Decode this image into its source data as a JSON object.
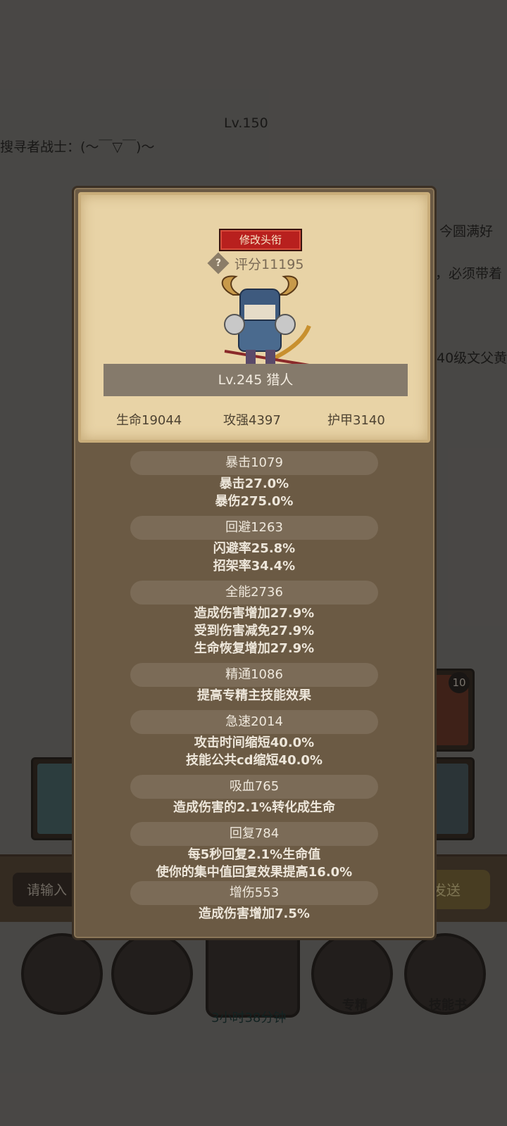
{
  "background": {
    "notice_right": "Lv.150",
    "chat_line": "搜寻者战士：(～￣▽￣)～",
    "side_text_1": "今圆满好",
    "side_text_2": "，必须带着",
    "side_text_3": "40级文父黄",
    "card_badge": "10",
    "input_placeholder": "请输入",
    "send_label": "发送",
    "btn_mastery": "专精",
    "btn_skillbook": "技能书",
    "timer": "3小时38分钟"
  },
  "modal": {
    "title_button": "修改头衔",
    "help": "?",
    "score": "评分11195",
    "level_class": "Lv.245 猎人",
    "primary_stats": {
      "hp": "生命19044",
      "atk": "攻强4397",
      "armor": "护甲3140"
    },
    "stats": [
      {
        "head": "暴击1079",
        "lines": [
          "暴击27.0%",
          "暴伤275.0%"
        ]
      },
      {
        "head": "回避1263",
        "lines": [
          "闪避率25.8%",
          "招架率34.4%"
        ]
      },
      {
        "head": "全能2736",
        "lines": [
          "造成伤害增加27.9%",
          "受到伤害减免27.9%",
          "生命恢复增加27.9%"
        ]
      },
      {
        "head": "精通1086",
        "lines": [
          "提高专精主技能效果"
        ]
      },
      {
        "head": "急速2014",
        "lines": [
          "攻击时间缩短40.0%",
          "技能公共cd缩短40.0%"
        ]
      },
      {
        "head": "吸血765",
        "lines": [
          "造成伤害的2.1%转化成生命"
        ]
      },
      {
        "head": "回复784",
        "lines": [
          "每5秒回复2.1%生命值",
          "使你的集中值回复效果提高16.0%"
        ]
      },
      {
        "head": "增伤553",
        "lines": [
          "造成伤害增加7.5%"
        ]
      }
    ]
  }
}
